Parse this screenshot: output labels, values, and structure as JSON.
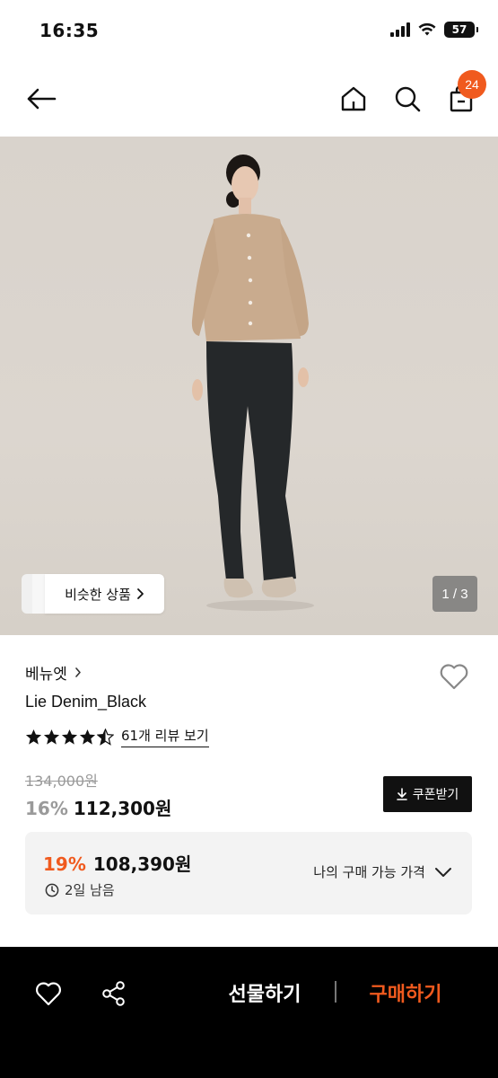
{
  "status_bar": {
    "time": "16:35",
    "battery": "57"
  },
  "nav": {
    "cart_count": "24",
    "icons": [
      "back-arrow-icon",
      "home-icon",
      "search-icon",
      "cart-icon"
    ]
  },
  "gallery": {
    "similar_label": "비슷한 상품",
    "counter": "1 / 3"
  },
  "product": {
    "brand": "베뉴엣",
    "name": "Lie Denim_Black",
    "rating": 4.5,
    "review_link": "61개 리뷰 보기",
    "original_price": "134,000원",
    "discount": "16%",
    "sale_price": "112,300원",
    "coupon_label": "쿠폰받기"
  },
  "my_price": {
    "discount": "19%",
    "price": "108,390원",
    "timer": "2일 남음",
    "toggle_label": "나의 구매 가능 가격"
  },
  "bottom_bar": {
    "gift_label": "선물하기",
    "buy_label": "구매하기"
  },
  "colors": {
    "accent": "#f05a1e",
    "bottom_bar_bg": "#000000",
    "price_box_bg": "#f3f3f3"
  }
}
